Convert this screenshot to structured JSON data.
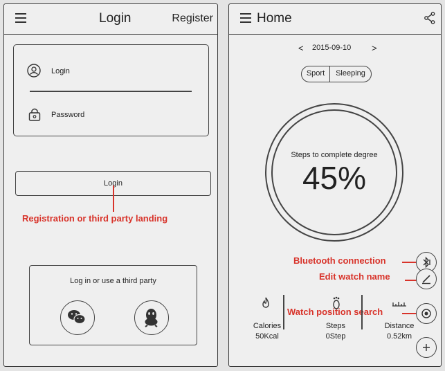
{
  "login_screen": {
    "title": "Login",
    "register_label": "Register",
    "login_field_label": "Login",
    "password_field_label": "Password",
    "login_button_label": "Login",
    "third_party_label": "Log in or use a third party",
    "annotation": "Registration or third party landing"
  },
  "home_screen": {
    "title": "Home",
    "date": "2015-09-10",
    "prev_symbol": "<",
    "next_symbol": ">",
    "tabs": [
      "Sport",
      "Sleeping"
    ],
    "ring_caption": "Steps to complete degree",
    "progress_text": "45%",
    "progress_fraction": 0.45,
    "stats": [
      {
        "label": "Calories",
        "value": "50Kcal"
      },
      {
        "label": "Steps",
        "value": "0Step"
      },
      {
        "label": "Distance",
        "value": "0.52km"
      }
    ],
    "annotations": {
      "bluetooth": "Bluetooth connection",
      "edit_name": "Edit watch name",
      "position_search": "Watch position search"
    }
  },
  "colors": {
    "annotation": "#d8332a",
    "stroke": "#444444",
    "background": "#efefef"
  }
}
